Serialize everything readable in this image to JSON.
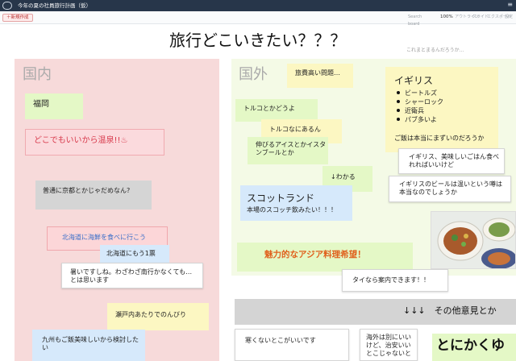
{
  "app": {
    "title": "今年の夏の社員旅行計画（仮）",
    "menu_icon": "≡",
    "new_button": "＋新規作成",
    "search_placeholder": "Search board",
    "zoom": "100%",
    "tools": [
      "アウトライン",
      "スライド",
      "エクスポート",
      "設定"
    ]
  },
  "board": {
    "heading": "旅行どこいきたい？？？",
    "subnote": "これまとまるんだろうか…",
    "domestic": {
      "label": "国内",
      "stickies": [
        {
          "text": "福岡"
        },
        {
          "text": "どこでもいいから温泉!!♨"
        },
        {
          "text": "普通に京都とかじゃだめなん?"
        },
        {
          "text": "北海道に海鮮を食べに行こう"
        },
        {
          "text": "北海道にもう1票"
        },
        {
          "text": "暑いですしね。わざわざ南行かなくても…とは思います"
        },
        {
          "text": "瀬戸内あたりでのんびり"
        },
        {
          "text": "九州もご飯美味しいから検討したい"
        }
      ]
    },
    "overseas": {
      "label": "国外",
      "stickies": [
        {
          "text": "旅費高い問題…"
        },
        {
          "text": "トルコとかどうよ"
        },
        {
          "text": "トルコなにあるん"
        },
        {
          "text": "伸びるアイスとかイスタンブールとか"
        },
        {
          "text": "↓わかる"
        },
        {
          "text": "スコットランド"
        },
        {
          "text": "本場のスコッチ飲みたい！！！"
        },
        {
          "text": "魅力的なアジア料理希望！"
        },
        {
          "text": "タイなら案内できます！！"
        }
      ],
      "uk": {
        "title": "イギリス",
        "bullets": [
          "ビートルズ",
          "シャーロック",
          "近衛兵",
          "パブ多いよ"
        ],
        "note": "ご飯は本当にまずいのだろうか"
      },
      "replies": [
        "イギリス、美味しいごはん食べれればいいけど",
        "イギリスのビールは温いという噂は本当なのでしょうか"
      ]
    },
    "other": {
      "header": "↓↓↓　その他意見とか",
      "items": [
        {
          "text": "寒くないとこがいいです"
        },
        {
          "text": "海外は別にいいけど、治安いいとこじゃないと"
        },
        {
          "text": "とにかくゆ"
        }
      ]
    }
  }
}
